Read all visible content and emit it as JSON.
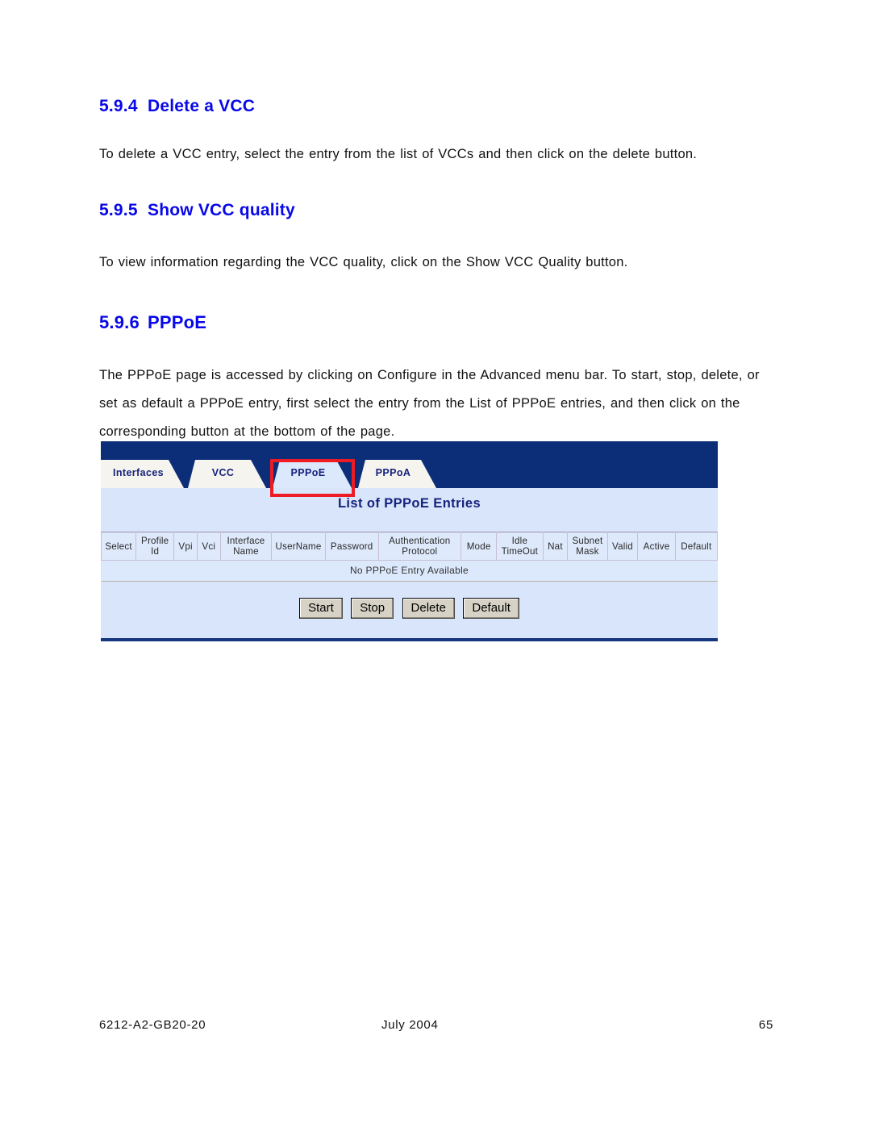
{
  "document": {
    "sections": [
      {
        "number": "5.9.4",
        "title": "Delete a VCC",
        "paragraph": "To delete a VCC entry, select the entry from the list of VCCs and then click on the delete button."
      },
      {
        "number": "5.9.5",
        "title": "Show VCC quality",
        "paragraph": "To view information regarding the VCC quality, click on the Show VCC Quality button."
      },
      {
        "number": "5.9.6",
        "title": "PPPoE",
        "paragraph": "The PPPoE page is accessed by clicking on Configure in the Advanced menu bar. To start, stop, delete, or set as default a PPPoE entry, first select the entry from the List of PPPoE entries, and then click on the corresponding button at the bottom of the page."
      }
    ]
  },
  "screenshot": {
    "tabs": [
      {
        "label": "Interfaces",
        "active": false
      },
      {
        "label": "VCC",
        "active": false
      },
      {
        "label": "PPPoE",
        "active": true
      },
      {
        "label": "PPPoA",
        "active": false
      }
    ],
    "highlight": {
      "target": "PPPoE",
      "color": "#ED1C24"
    },
    "panel_title": "List of PPPoE Entries",
    "table": {
      "columns": [
        "Select",
        "Profile Id",
        "Vpi",
        "Vci",
        "Interface Name",
        "UserName",
        "Password",
        "Authentication Protocol",
        "Mode",
        "Idle TimeOut",
        "Nat",
        "Subnet Mask",
        "Valid",
        "Active",
        "Default"
      ],
      "empty_message": "No PPPoE Entry Available",
      "rows": []
    },
    "buttons": [
      {
        "label": "Start"
      },
      {
        "label": "Stop"
      },
      {
        "label": "Delete"
      },
      {
        "label": "Default"
      }
    ],
    "colors": {
      "header_blue": "#0C2E78",
      "content_blue": "#D8E5FA",
      "tab_inactive": "#F6F4EE",
      "tab_text": "#16227C",
      "highlight_red": "#ED1C24",
      "button_face": "#D6D2C6"
    }
  },
  "footer": {
    "doc_number": "6212-A2-GB20-20",
    "date": "July 2004",
    "page_number": "65"
  }
}
